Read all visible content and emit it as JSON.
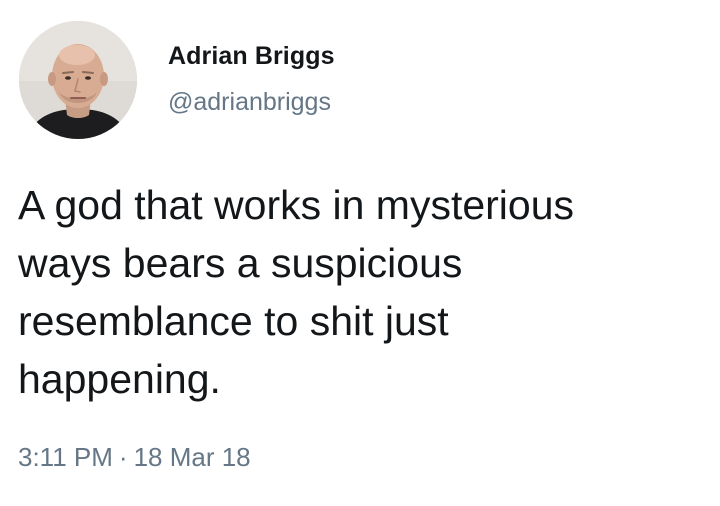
{
  "user": {
    "display_name": "Adrian Briggs",
    "handle": "@adrianbriggs",
    "avatar_icon": "profile-photo-avatar"
  },
  "tweet": {
    "lines": [
      "A god that works in mysterious",
      "ways bears a suspicious",
      "resemblance to shit just",
      "happening."
    ],
    "time": "3:11 PM",
    "separator": "·",
    "date": "18 Mar 18"
  },
  "colors": {
    "primary_text": "#14171a",
    "secondary_text": "#657786",
    "background": "#ffffff"
  }
}
